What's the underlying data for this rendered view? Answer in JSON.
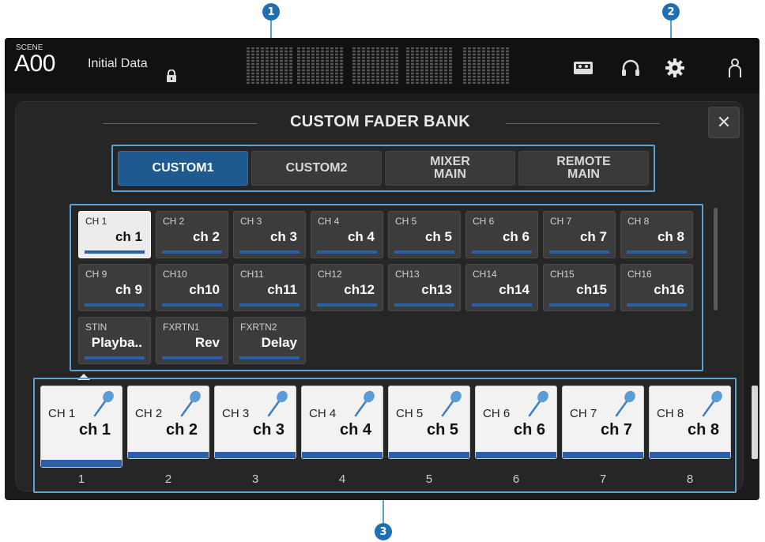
{
  "callouts": {
    "c1": "1",
    "c2": "2",
    "c3": "3"
  },
  "topbar": {
    "scene_small": "SCENE",
    "scene_number": "A00",
    "scene_title": "Initial Data",
    "icons": [
      "lock-icon",
      "recorder-icon",
      "headphones-icon",
      "gear-icon",
      "user-icon"
    ]
  },
  "panel": {
    "title": "CUSTOM FADER BANK",
    "close": "✕"
  },
  "tabs": [
    {
      "label": "CUSTOM1",
      "active": true
    },
    {
      "label": "CUSTOM2",
      "active": false
    },
    {
      "label": "MIXER\nMAIN",
      "active": false
    },
    {
      "label": "REMOTE\nMAIN",
      "active": false
    }
  ],
  "grid": [
    {
      "label": "CH 1",
      "name": "ch 1"
    },
    {
      "label": "CH 2",
      "name": "ch 2"
    },
    {
      "label": "CH 3",
      "name": "ch 3"
    },
    {
      "label": "CH 4",
      "name": "ch 4"
    },
    {
      "label": "CH 5",
      "name": "ch 5"
    },
    {
      "label": "CH 6",
      "name": "ch 6"
    },
    {
      "label": "CH 7",
      "name": "ch 7"
    },
    {
      "label": "CH 8",
      "name": "ch 8"
    },
    {
      "label": "CH 9",
      "name": "ch 9"
    },
    {
      "label": "CH10",
      "name": "ch10"
    },
    {
      "label": "CH11",
      "name": "ch11"
    },
    {
      "label": "CH12",
      "name": "ch12"
    },
    {
      "label": "CH13",
      "name": "ch13"
    },
    {
      "label": "CH14",
      "name": "ch14"
    },
    {
      "label": "CH15",
      "name": "ch15"
    },
    {
      "label": "CH16",
      "name": "ch16"
    },
    {
      "label": "STIN",
      "name": "Playba.."
    },
    {
      "label": "FXRTN1",
      "name": "Rev"
    },
    {
      "label": "FXRTN2",
      "name": "Delay"
    }
  ],
  "strip": [
    {
      "label": "CH 1",
      "name": "ch 1",
      "number": "1"
    },
    {
      "label": "CH 2",
      "name": "ch 2",
      "number": "2"
    },
    {
      "label": "CH 3",
      "name": "ch 3",
      "number": "3"
    },
    {
      "label": "CH 4",
      "name": "ch 4",
      "number": "4"
    },
    {
      "label": "CH 5",
      "name": "ch 5",
      "number": "5"
    },
    {
      "label": "CH 6",
      "name": "ch 6",
      "number": "6"
    },
    {
      "label": "CH 7",
      "name": "ch 7",
      "number": "7"
    },
    {
      "label": "CH 8",
      "name": "ch 8",
      "number": "8"
    }
  ],
  "colors": {
    "accent": "#1e5a8f",
    "callout": "#1f6fb2",
    "bar": "#2c5fa8"
  }
}
